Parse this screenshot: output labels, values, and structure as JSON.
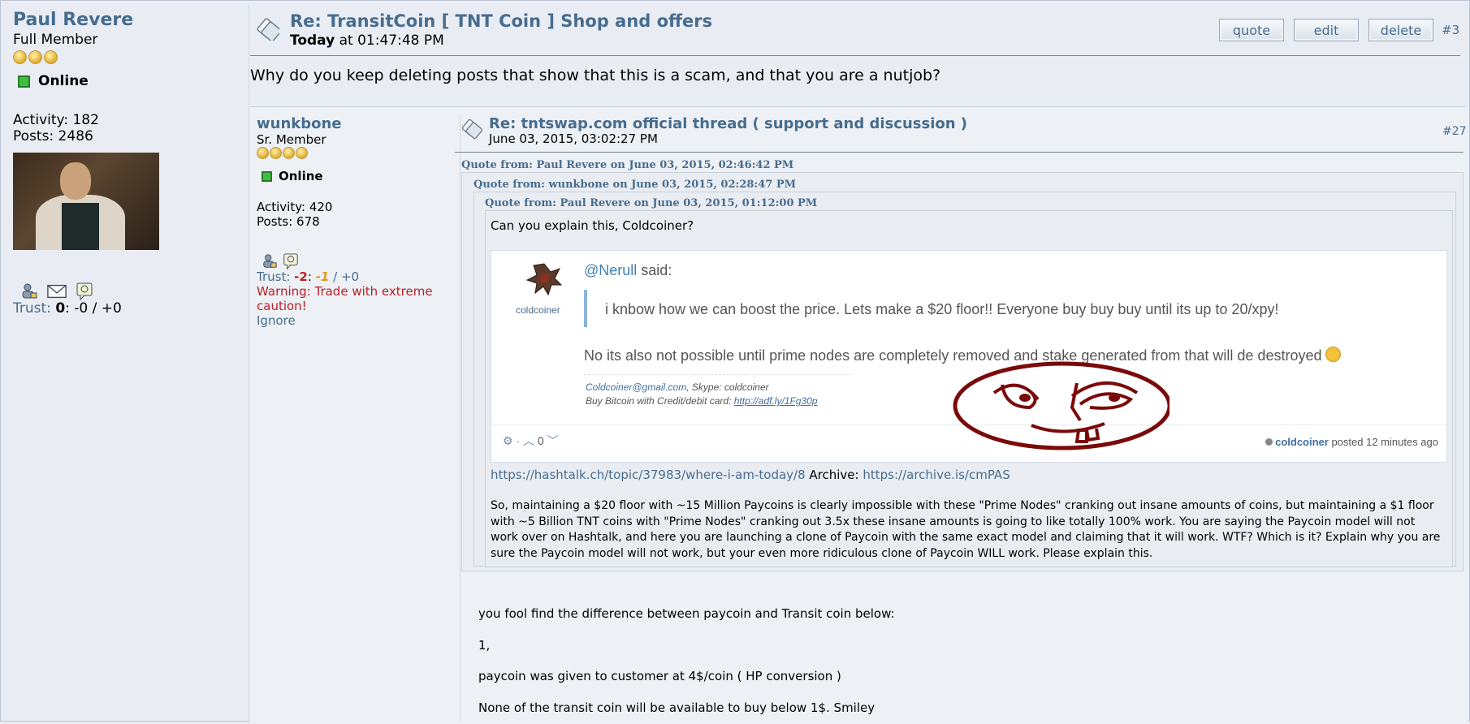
{
  "poster": {
    "name": "Paul Revere",
    "rank": "Full Member",
    "status": "Online",
    "activity": "Activity: 182",
    "posts": "Posts: 2486",
    "trust_label": "Trust:",
    "trust_value": "0",
    "trust_rest": ": -0 / +0"
  },
  "post": {
    "title": "Re: TransitCoin [ TNT Coin ] Shop and offers",
    "date_bold": "Today",
    "date_rest": " at 01:47:48 PM",
    "message": "Why do you keep deleting posts that show that this is a scam, and that you are a nutjob?",
    "number": "#3",
    "buttons": {
      "quote": "quote",
      "edit": "edit",
      "delete": "delete"
    }
  },
  "inner_user": {
    "name": "wunkbone",
    "rank": "Sr. Member",
    "status": "Online",
    "activity": "Activity: 420",
    "posts": "Posts: 678",
    "trust_label": "Trust:",
    "trust_neg": "-2",
    "trust_sep": ":",
    "trust_mid": "-1",
    "trust_pos": "/ +0",
    "warning": "Warning: Trade with extreme caution!",
    "ignore": "Ignore"
  },
  "inner_post": {
    "title": "Re: tntswap.com official thread ( support and discussion )",
    "date": "June 03, 2015, 03:02:27 PM",
    "number": "#27",
    "quote1_header": "Quote from: Paul Revere on June 03, 2015, 02:46:42 PM",
    "quote2_header": "Quote from: wunkbone on June 03, 2015, 02:28:47 PM",
    "quote3_header": "Quote from: Paul Revere on June 03, 2015, 01:12:00 PM",
    "quote3_text": "Can you explain this, Coldcoiner?",
    "card": {
      "username": "coldcoiner",
      "mention": "@Nerull",
      "said": " said:",
      "quote": "i knbow how we can boost the price. Lets make a $20 floor!! Everyone buy buy buy until its up to 20/xpy!",
      "reply": "No its also not possible until prime nodes are completely removed and stake generated from that will de destroyed ",
      "sig_email": "Coldcoiner@gmail.com",
      "sig_skype": ", Skype: coldcoiner",
      "sig_buy": "Buy Bitcoin with Credit/debit card: ",
      "sig_link": "http://adf.ly/1Fg30p",
      "vote_count": "0",
      "posted_user": "coldcoiner",
      "posted_rest": " posted 12 minutes ago"
    },
    "link1": "https://hashtalk.ch/topic/37983/where-i-am-today/8",
    "archive_label": " Archive: ",
    "link2": "https://archive.is/cmPAS",
    "paragraph": "So, maintaining a $20 floor with ~15 Million Paycoins is clearly impossible with these \"Prime Nodes\" cranking out insane amounts of coins, but maintaining a $1 floor with ~5 Billion TNT coins with \"Prime Nodes\" cranking out 3.5x these insane amounts is going to like totally 100% work. You are saying the Paycoin model will not work over on Hashtalk, and here you are launching a clone of Paycoin with the same exact model and claiming that it will work. WTF? Which is it? Explain why you are sure the Paycoin model will not work, but your even more ridiculous clone of Paycoin WILL work. Please explain this.",
    "reply_line1": "you fool find the difference between paycoin and Transit coin below:",
    "reply_line2": "1,",
    "reply_line3": "paycoin was given to customer at 4$/coin ( HP conversion )",
    "reply_line4": "None of the transit coin will be available to buy below 1$. Smiley"
  },
  "colors": {
    "link": "#476c8e",
    "warning": "#b8202a",
    "background": "#e9edf3",
    "online": "#3fbf3f"
  }
}
